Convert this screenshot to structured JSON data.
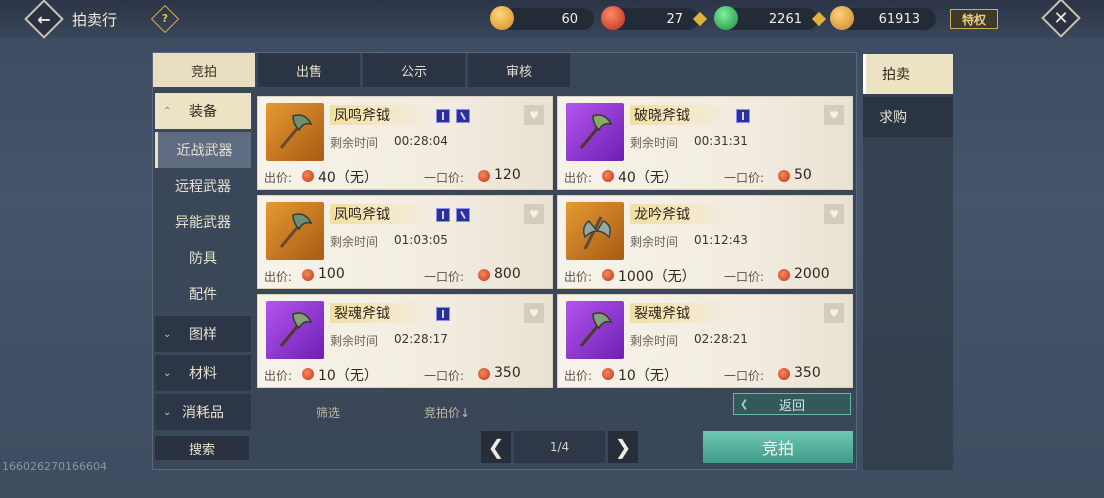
{
  "header": {
    "title": "拍卖行",
    "help_label": "?",
    "vip_label": "特权",
    "currencies": [
      {
        "value": "60",
        "icon": "gold-coin-icon",
        "color": "#e7a63a"
      },
      {
        "value": "27",
        "icon": "red-gem-icon",
        "color": "#d9452c"
      },
      {
        "value": "2261",
        "icon": "green-gem-icon",
        "color": "#2fae4f"
      },
      {
        "value": "61913",
        "icon": "gold-ingot-icon",
        "color": "#e1a53f"
      }
    ]
  },
  "tabs": [
    {
      "label": "竞拍",
      "active": true
    },
    {
      "label": "出售",
      "active": false
    },
    {
      "label": "公示",
      "active": false
    },
    {
      "label": "审核",
      "active": false
    }
  ],
  "side_tabs": [
    {
      "label": "拍卖",
      "active": true
    },
    {
      "label": "求购",
      "active": false
    }
  ],
  "categories": {
    "equipment": "装备",
    "sub_items": [
      "近战武器",
      "远程武器",
      "异能武器",
      "防具",
      "配件"
    ],
    "collapsed": [
      "图样",
      "材料",
      "消耗品"
    ]
  },
  "labels": {
    "time_left": "剩余时间",
    "bid": "出价:",
    "buyout": "一口价:"
  },
  "items": [
    {
      "name": "凤鸣斧钺",
      "rarity": "orange",
      "time": "00:28:04",
      "bid": "40（无）",
      "buyout": "120",
      "gems": 2
    },
    {
      "name": "破晓斧钺",
      "rarity": "purple",
      "time": "00:31:31",
      "bid": "40（无）",
      "buyout": "50",
      "gems": 1
    },
    {
      "name": "凤鸣斧钺",
      "rarity": "orange",
      "time": "01:03:05",
      "bid": "100",
      "buyout": "800",
      "gems": 2
    },
    {
      "name": "龙吟斧钺",
      "rarity": "orange",
      "time": "01:12:43",
      "bid": "1000（无）",
      "buyout": "2000",
      "gems": 0
    },
    {
      "name": "裂魂斧钺",
      "rarity": "purple",
      "time": "02:28:17",
      "bid": "10（无）",
      "buyout": "350",
      "gems": 1
    },
    {
      "name": "裂魂斧钺",
      "rarity": "purple",
      "time": "02:28:21",
      "bid": "10（无）",
      "buyout": "350",
      "gems": 0
    }
  ],
  "controls": {
    "filter": "筛选",
    "sort": "竞拍价↓",
    "return": "返回",
    "search": "搜索",
    "page": "1/4",
    "bid_button": "竞拍"
  },
  "uid": "166026270166604"
}
